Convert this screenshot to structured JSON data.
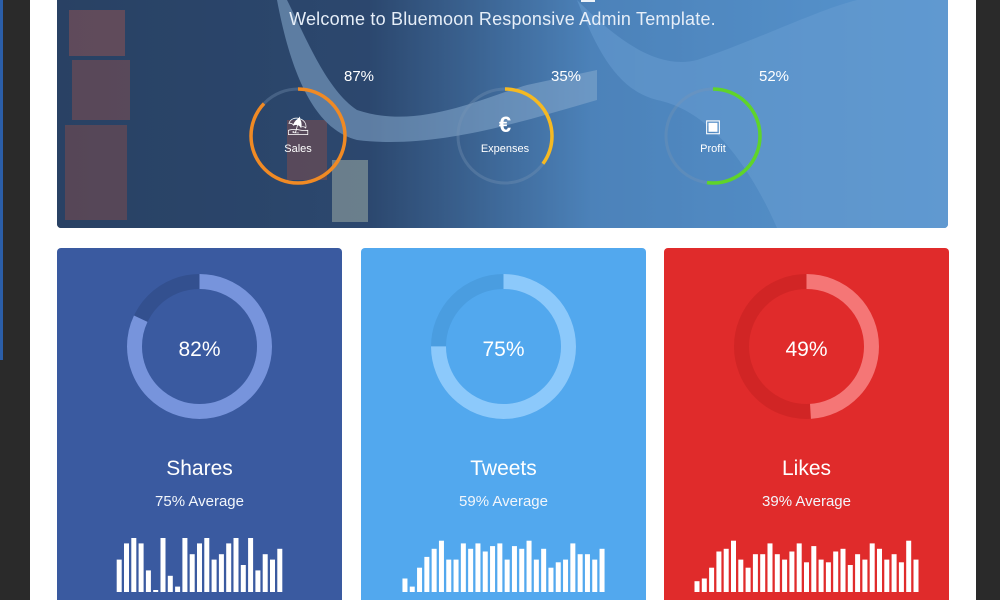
{
  "hero": {
    "subtitle": "Welcome to Bluemoon Responsive Admin Template.",
    "gauges": [
      {
        "label": "Sales",
        "percent_text": "87%",
        "value": 87,
        "color": "#f08a24",
        "icon": "beach-umbrella-icon",
        "glyph": "⛱"
      },
      {
        "label": "Expenses",
        "percent_text": "35%",
        "value": 35,
        "color": "#f5b922",
        "icon": "euro-icon",
        "glyph": "€"
      },
      {
        "label": "Profit",
        "percent_text": "52%",
        "value": 52,
        "color": "#5fd42a",
        "icon": "wallet-icon",
        "glyph": "▣"
      }
    ]
  },
  "cards": [
    {
      "title": "Shares",
      "average": "75% Average",
      "percent_text": "82%",
      "value": 82,
      "bg": "#3a5aa0",
      "ring_bg": "#33508f",
      "ring_fg": "#7794dc",
      "bars": [
        0.6,
        0.9,
        1.0,
        0.9,
        0.4,
        0.0,
        1.0,
        0.3,
        0.1,
        1.0,
        0.7,
        0.9,
        1.0,
        0.6,
        0.7,
        0.9,
        1.0,
        0.5,
        1.0,
        0.4,
        0.7,
        0.6,
        0.8
      ]
    },
    {
      "title": "Tweets",
      "average": "59% Average",
      "percent_text": "75%",
      "value": 75,
      "bg": "#52a8ee",
      "ring_bg": "#4a9de0",
      "ring_fg": "#8cc9fb",
      "bars": [
        0.25,
        0.1,
        0.45,
        0.65,
        0.8,
        0.95,
        0.6,
        0.6,
        0.9,
        0.8,
        0.9,
        0.75,
        0.85,
        0.9,
        0.6,
        0.85,
        0.8,
        0.95,
        0.6,
        0.8,
        0.45,
        0.55,
        0.6,
        0.9,
        0.7,
        0.7,
        0.6,
        0.8
      ]
    },
    {
      "title": "Likes",
      "average": "39% Average",
      "percent_text": "49%",
      "value": 49,
      "bg": "#e02b2b",
      "ring_bg": "#d12525",
      "ring_fg": "#f57676",
      "bars": [
        0.2,
        0.25,
        0.45,
        0.75,
        0.8,
        0.95,
        0.6,
        0.45,
        0.7,
        0.7,
        0.9,
        0.7,
        0.6,
        0.75,
        0.9,
        0.55,
        0.85,
        0.6,
        0.55,
        0.75,
        0.8,
        0.5,
        0.7,
        0.6,
        0.9,
        0.8,
        0.6,
        0.7,
        0.55,
        0.95,
        0.6
      ]
    }
  ]
}
